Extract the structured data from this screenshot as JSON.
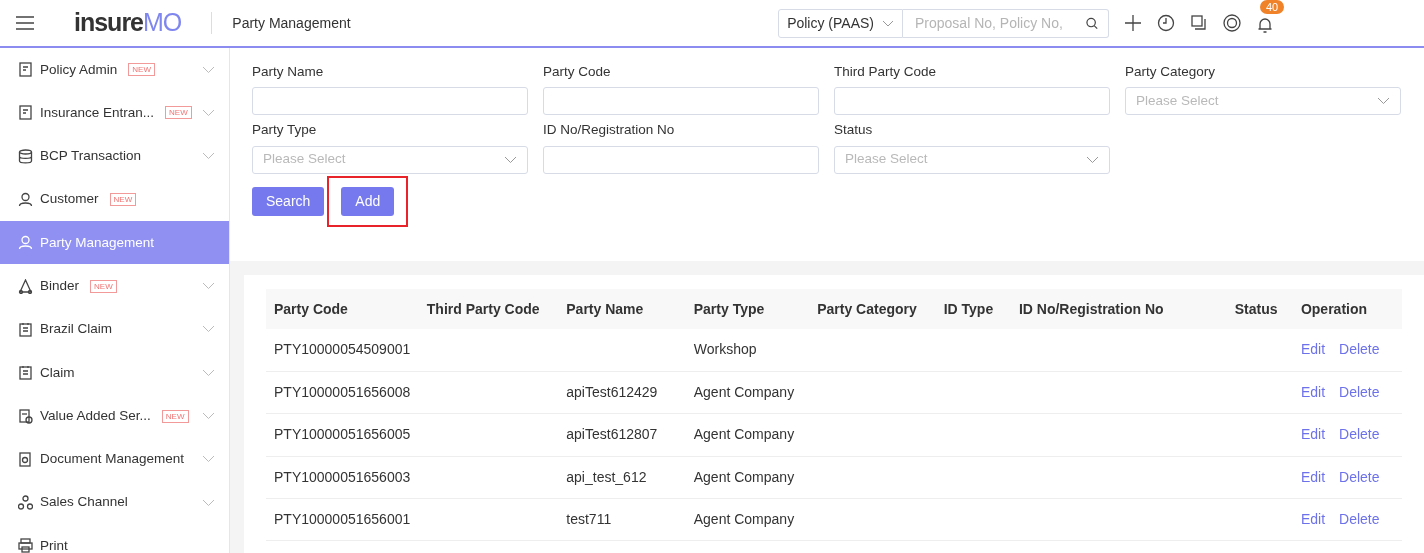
{
  "header": {
    "logo": [
      "insure",
      "MO"
    ],
    "page_title": "Party Management",
    "scope_select": "Policy (PAAS)",
    "search": {
      "placeholder": "Proposal No, Policy No,"
    },
    "notification_count": "40"
  },
  "sidebar": {
    "items": [
      {
        "label": "Policy Admin",
        "new_badge": "NEW",
        "expandable": true,
        "selected": false
      },
      {
        "label": "Insurance Entran...",
        "new_badge": "NEW",
        "expandable": true,
        "selected": false
      },
      {
        "label": "BCP Transaction",
        "expandable": true,
        "selected": false
      },
      {
        "label": "Customer",
        "new_badge": "NEW",
        "expandable": false,
        "selected": false
      },
      {
        "label": "Party Management",
        "expandable": false,
        "selected": true
      },
      {
        "label": "Binder",
        "new_badge": "NEW",
        "expandable": true,
        "selected": false
      },
      {
        "label": "Brazil Claim",
        "expandable": true,
        "selected": false
      },
      {
        "label": "Claim",
        "expandable": true,
        "selected": false
      },
      {
        "label": "Value Added Ser...",
        "new_badge": "NEW",
        "expandable": true,
        "selected": false
      },
      {
        "label": "Document Management",
        "expandable": true,
        "selected": false
      },
      {
        "label": "Sales Channel",
        "expandable": true,
        "selected": false
      },
      {
        "label": "Print",
        "expandable": false,
        "selected": false
      }
    ]
  },
  "filters": [
    {
      "label": "Party Name",
      "kind": "text"
    },
    {
      "label": "Party Code",
      "kind": "text"
    },
    {
      "label": "Third Party Code",
      "kind": "text"
    },
    {
      "label": "Party Category",
      "kind": "select",
      "placeholder": "Please Select"
    },
    {
      "label": "Party Type",
      "kind": "select",
      "placeholder": "Please Select"
    },
    {
      "label": "ID No/Registration No",
      "kind": "text"
    },
    {
      "label": "Status",
      "kind": "select",
      "placeholder": "Please Select"
    }
  ],
  "buttons": [
    {
      "label": "Search",
      "highlighted": false
    },
    {
      "label": "Add",
      "highlighted": true
    }
  ],
  "table": {
    "columns": [
      "Party Code",
      "Third Party Code",
      "Party Name",
      "Party Type",
      "Party Category",
      "ID Type",
      "ID No/Registration No",
      "Status",
      "Operation"
    ],
    "rows": [
      {
        "cells": [
          "PTY10000054509001",
          "",
          "",
          "Workshop",
          "",
          "",
          "",
          ""
        ],
        "actions": [
          "Edit",
          "Delete"
        ]
      },
      {
        "cells": [
          "PTY10000051656008",
          "",
          "apiTest612429",
          "Agent Company",
          "",
          "",
          "",
          ""
        ],
        "actions": [
          "Edit",
          "Delete"
        ]
      },
      {
        "cells": [
          "PTY10000051656005",
          "",
          "apiTest612807",
          "Agent Company",
          "",
          "",
          "",
          ""
        ],
        "actions": [
          "Edit",
          "Delete"
        ]
      },
      {
        "cells": [
          "PTY10000051656003",
          "",
          "api_test_612",
          "Agent Company",
          "",
          "",
          "",
          ""
        ],
        "actions": [
          "Edit",
          "Delete"
        ]
      },
      {
        "cells": [
          "PTY10000051656001",
          "",
          "test711",
          "Agent Company",
          "",
          "",
          "",
          ""
        ],
        "actions": [
          "Edit",
          "Delete"
        ]
      }
    ]
  }
}
